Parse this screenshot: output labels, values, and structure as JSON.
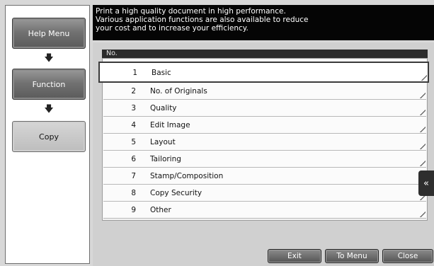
{
  "header": {
    "message_lines": [
      "Print a high quality document in high performance.",
      "Various application functions are also available to reduce",
      "your cost and to increase your efficiency."
    ]
  },
  "left_nav": {
    "help_menu": "Help Menu",
    "function": "Function",
    "copy": "Copy",
    "arrow_icon": "down-arrow"
  },
  "list": {
    "column_header": "No.",
    "rows": [
      {
        "num": "1",
        "label": "Basic"
      },
      {
        "num": "2",
        "label": "No. of Originals"
      },
      {
        "num": "3",
        "label": "Quality"
      },
      {
        "num": "4",
        "label": "Edit Image"
      },
      {
        "num": "5",
        "label": "Layout"
      },
      {
        "num": "6",
        "label": "Tailoring"
      },
      {
        "num": "7",
        "label": "Stamp/Composition"
      },
      {
        "num": "8",
        "label": "Copy Security"
      },
      {
        "num": "9",
        "label": "Other"
      }
    ],
    "selected_index": 0
  },
  "side_tab": {
    "icon": "double-chevron-left-icon"
  },
  "footer": {
    "exit": "Exit",
    "to_menu": "To Menu",
    "close": "Close"
  }
}
